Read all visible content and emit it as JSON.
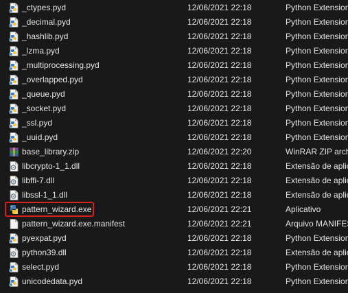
{
  "files": [
    {
      "name": "_ctypes.pyd",
      "date": "12/06/2021 22:18",
      "type": "Python Extension",
      "icon": "python-extension-icon"
    },
    {
      "name": "_decimal.pyd",
      "date": "12/06/2021 22:18",
      "type": "Python Extension",
      "icon": "python-extension-icon"
    },
    {
      "name": "_hashlib.pyd",
      "date": "12/06/2021 22:18",
      "type": "Python Extension",
      "icon": "python-extension-icon"
    },
    {
      "name": "_lzma.pyd",
      "date": "12/06/2021 22:18",
      "type": "Python Extension",
      "icon": "python-extension-icon"
    },
    {
      "name": "_multiprocessing.pyd",
      "date": "12/06/2021 22:18",
      "type": "Python Extension",
      "icon": "python-extension-icon"
    },
    {
      "name": "_overlapped.pyd",
      "date": "12/06/2021 22:18",
      "type": "Python Extension",
      "icon": "python-extension-icon"
    },
    {
      "name": "_queue.pyd",
      "date": "12/06/2021 22:18",
      "type": "Python Extension",
      "icon": "python-extension-icon"
    },
    {
      "name": "_socket.pyd",
      "date": "12/06/2021 22:18",
      "type": "Python Extension",
      "icon": "python-extension-icon"
    },
    {
      "name": "_ssl.pyd",
      "date": "12/06/2021 22:18",
      "type": "Python Extension",
      "icon": "python-extension-icon"
    },
    {
      "name": "_uuid.pyd",
      "date": "12/06/2021 22:18",
      "type": "Python Extension",
      "icon": "python-extension-icon"
    },
    {
      "name": "base_library.zip",
      "date": "12/06/2021 22:20",
      "type": "WinRAR ZIP archi",
      "icon": "winrar-archive-icon"
    },
    {
      "name": "libcrypto-1_1.dll",
      "date": "12/06/2021 22:18",
      "type": "Extensão de aplic",
      "icon": "dll-icon"
    },
    {
      "name": "libffi-7.dll",
      "date": "12/06/2021 22:18",
      "type": "Extensão de aplic",
      "icon": "dll-icon"
    },
    {
      "name": "libssl-1_1.dll",
      "date": "12/06/2021 22:18",
      "type": "Extensão de aplic",
      "icon": "dll-icon"
    },
    {
      "name": "pattern_wizard.exe",
      "date": "12/06/2021 22:21",
      "type": "Aplicativo",
      "icon": "python-exe-icon"
    },
    {
      "name": "pattern_wizard.exe.manifest",
      "date": "12/06/2021 22:21",
      "type": "Arquivo MANIFES",
      "icon": "blank-file-icon"
    },
    {
      "name": "pyexpat.pyd",
      "date": "12/06/2021 22:18",
      "type": "Python Extension",
      "icon": "python-extension-icon"
    },
    {
      "name": "python39.dll",
      "date": "12/06/2021 22:18",
      "type": "Extensão de aplic",
      "icon": "dll-icon"
    },
    {
      "name": "select.pyd",
      "date": "12/06/2021 22:18",
      "type": "Python Extension",
      "icon": "python-extension-icon"
    },
    {
      "name": "unicodedata.pyd",
      "date": "12/06/2021 22:18",
      "type": "Python Extension",
      "icon": "python-extension-icon"
    }
  ],
  "highlighted_file": "pattern_wizard.exe",
  "colors": {
    "background": "#191919",
    "text": "#e6e6e6",
    "highlight_border": "#d82020"
  }
}
